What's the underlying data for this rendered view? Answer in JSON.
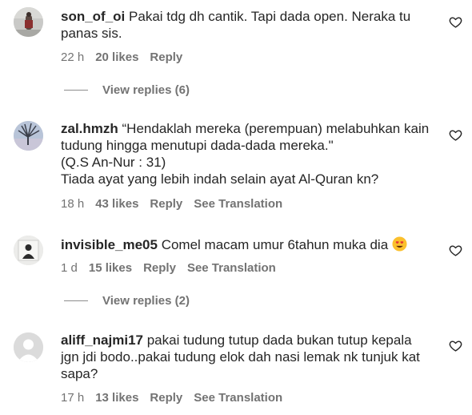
{
  "comments": [
    {
      "username": "son_of_oi",
      "text": " Pakai tdg dh cantik. Tapi dada open. Neraka tu\npanas sis.",
      "time": "22 h",
      "likes": "20 likes",
      "reply": "Reply",
      "view_replies": "View replies (6)"
    },
    {
      "username": "zal.hmzh",
      "text": " “Hendaklah mereka (perempuan) melabuhkan kain\ntudung hingga menutupi dada-dada mereka.\"\n(Q.S An-Nur : 31)\nTiada ayat yang lebih indah selain ayat Al-Quran kn?",
      "time": "18 h",
      "likes": "43 likes",
      "reply": "Reply",
      "translation": "See Translation"
    },
    {
      "username": "invisible_me05",
      "text": " Comel macam umur 6tahun muka dia ",
      "emoji": "heart-eyes-emoji",
      "time": "1 d",
      "likes": "15 likes",
      "reply": "Reply",
      "translation": "See Translation",
      "view_replies": "View replies (2)"
    },
    {
      "username": "aliff_najmi17",
      "text": " pakai tudung tutup dada bukan tutup kepala\njgn jdi bodo..pakai tudung elok dah nasi lemak nk tunjuk kat\nsapa?",
      "time": "17 h",
      "likes": "13 likes",
      "reply": "Reply",
      "translation": "See Translation"
    }
  ],
  "colors": {
    "text": "#262626",
    "secondary": "#737373",
    "divider": "#8e8e8e"
  },
  "icons": {
    "like": "heart-outline-icon",
    "avatar_default": "default-avatar-icon"
  }
}
